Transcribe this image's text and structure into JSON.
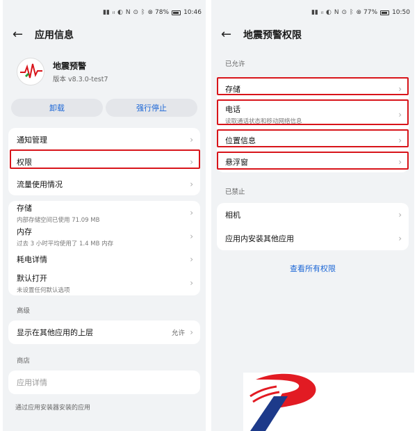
{
  "left": {
    "status": {
      "icons": [
        "nfc-icon",
        "alarm-icon",
        "bluetooth-icon"
      ],
      "battery": "78%",
      "time": "10:46"
    },
    "title": "应用信息",
    "app": {
      "name": "地震预警",
      "version": "版本 v8.3.0-test7"
    },
    "buttons": {
      "uninstall": "卸载",
      "force_stop": "强行停止"
    },
    "card1": [
      {
        "label": "通知管理"
      },
      {
        "label": "权限"
      },
      {
        "label": "流量使用情况"
      }
    ],
    "card2": [
      {
        "label": "存储",
        "sub": "内部存储空间已使用 71.09 MB"
      },
      {
        "label": "内存",
        "sub": "过去 3 小时平均使用了 1.4 MB 内存"
      },
      {
        "label": "耗电详情"
      },
      {
        "label": "默认打开",
        "sub": "未设置任何默认选项"
      }
    ],
    "advanced_label": "高级",
    "overlay": {
      "label": "显示在其他应用的上层",
      "value": "允许"
    },
    "store_label": "商店",
    "app_details": "应用详情",
    "installer_note": "通过应用安装器安装的应用"
  },
  "right": {
    "status": {
      "battery": "77%",
      "time": "10:50"
    },
    "title": "地震预警权限",
    "allowed_label": "已允许",
    "allowed": [
      {
        "label": "存储"
      },
      {
        "label": "电话",
        "sub": "读取通话状态和移动网络信息"
      },
      {
        "label": "位置信息"
      },
      {
        "label": "悬浮窗"
      }
    ],
    "denied_label": "已禁止",
    "denied": [
      {
        "label": "相机"
      },
      {
        "label": "应用内安装其他应用"
      }
    ],
    "view_all": "查看所有权限"
  },
  "colors": {
    "accent": "#1b66d6",
    "highlight": "#d8141a",
    "brand_red": "#e21b23",
    "brand_blue": "#1d3a8a"
  }
}
